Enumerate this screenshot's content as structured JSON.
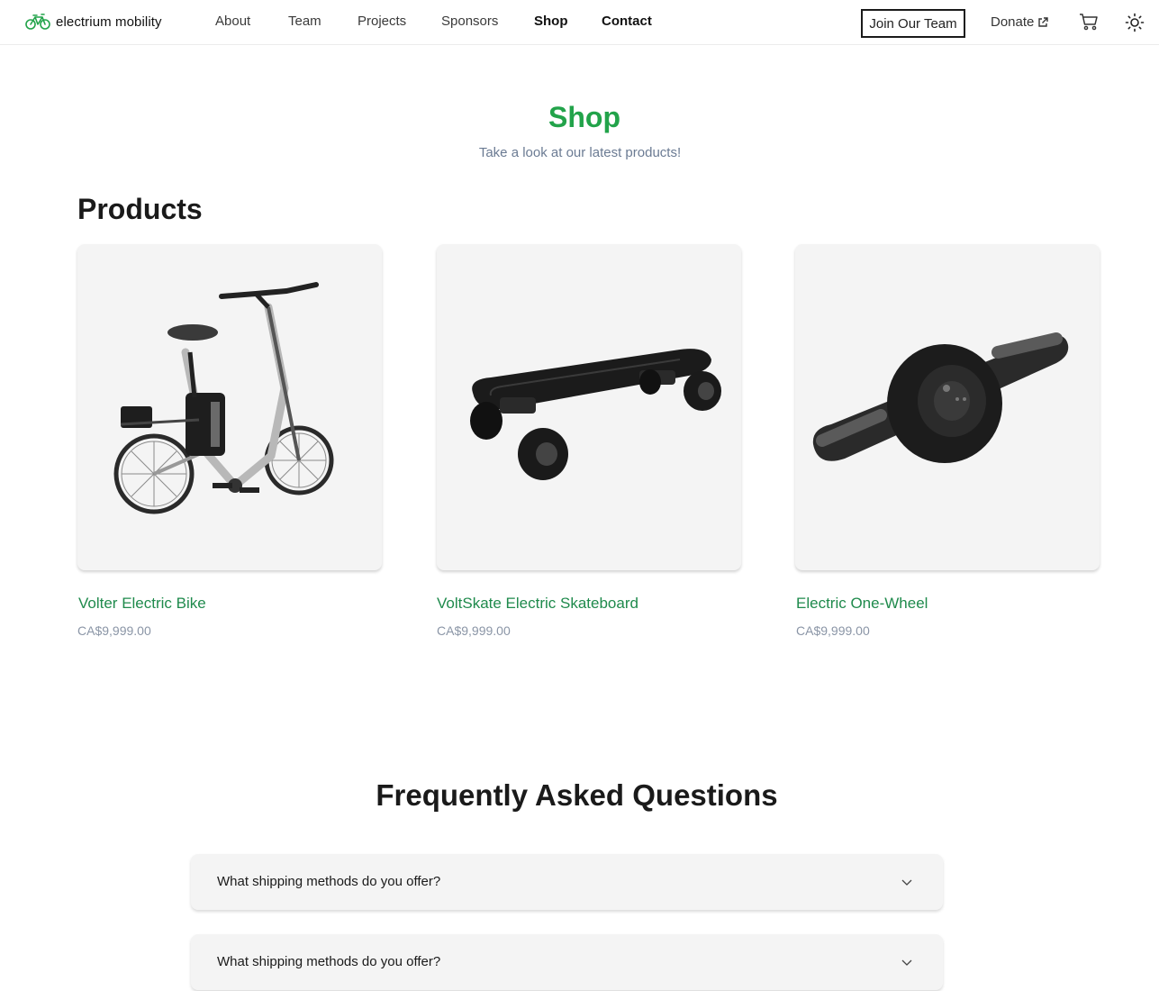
{
  "nav": {
    "brand": "electrium mobility",
    "links": [
      "About",
      "Team",
      "Projects",
      "Sponsors",
      "Shop",
      "Contact"
    ],
    "join_label": "Join Our Team",
    "donate_label": "Donate"
  },
  "hero": {
    "title": "Shop",
    "subtitle": "Take a look at our latest products!"
  },
  "products": {
    "heading": "Products",
    "items": [
      {
        "name": "Volter Electric Bike",
        "price": "CA$9,999.00",
        "image": "electric-bike"
      },
      {
        "name": "VoltSkate Electric Skateboard",
        "price": "CA$9,999.00",
        "image": "electric-skateboard"
      },
      {
        "name": "Electric One-Wheel",
        "price": "CA$9,999.00",
        "image": "electric-one-wheel"
      }
    ]
  },
  "faq": {
    "heading": "Frequently Asked Questions",
    "items": [
      {
        "question": "What shipping methods do you offer?"
      },
      {
        "question": "What shipping methods do you offer?"
      }
    ]
  },
  "colors": {
    "accent": "#22a34a",
    "product_name": "#1f8a4c",
    "price": "#8a95a6",
    "card_bg": "#f4f4f4"
  },
  "icons": [
    "bike-logo-icon",
    "external-link-icon",
    "cart-icon",
    "sun-icon",
    "chevron-down-icon"
  ]
}
